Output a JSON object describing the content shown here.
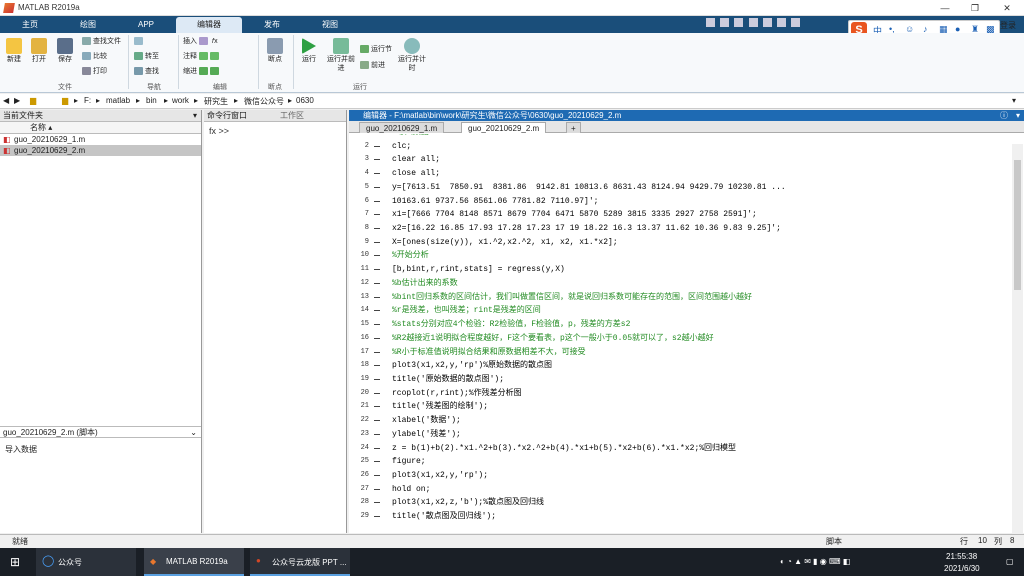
{
  "window": {
    "title": "MATLAB R2019a",
    "login": "登录"
  },
  "tabs": [
    "主页",
    "绘图",
    "APP",
    "编辑器",
    "发布",
    "视图"
  ],
  "ime": {
    "logo": "S",
    "lang": "中"
  },
  "ribbon": {
    "file": {
      "new": "新建",
      "open": "打开",
      "save": "保存",
      "find_files": "查找文件",
      "compare": "比较",
      "print": "打印",
      "group": "文件"
    },
    "nav": {
      "goto": "转至",
      "find": "查找",
      "group": "导航"
    },
    "edit": {
      "insert": "插入",
      "comment": "注释",
      "indent": "缩进",
      "group": "编辑"
    },
    "breakpoints": {
      "label": "断点",
      "group": "断点"
    },
    "run": {
      "run": "运行",
      "run_advance": "运行并前进",
      "run_section": "运行节",
      "advance": "前进",
      "run_time": "运行并计时",
      "group": "运行"
    }
  },
  "address": {
    "parts": [
      "F:",
      "matlab",
      "bin",
      "work",
      "研究生",
      "微信公众号",
      "0630"
    ]
  },
  "current_folder": {
    "title": "当前文件夹",
    "col": "名称 ▴",
    "files": [
      "guo_20210629_1.m",
      "guo_20210629_2.m"
    ],
    "selected": 1,
    "detail_title": "guo_20210629_2.m (脚本)",
    "detail_text": "导入数据"
  },
  "command_window": {
    "title": "命令行窗口",
    "workspace": "工作区",
    "prompt": "fx >>"
  },
  "editor": {
    "title": "编辑器 - F:\\matlab\\bin\\work\\研究生\\微信公众号\\0630\\guo_20210629_2.m",
    "tabs": [
      "guo_20210629_1.m",
      "guo_20210629_2.m"
    ],
    "active_tab": 1,
    "lines": [
      {
        "n": "1",
        "t": "%导入数据",
        "c": true
      },
      {
        "n": "2",
        "t": "clc;"
      },
      {
        "n": "3",
        "t": "clear all;"
      },
      {
        "n": "4",
        "t": "close all;"
      },
      {
        "n": "5",
        "t": "y=[7613.51  7850.91  8381.86  9142.81 10813.6 8631.43 8124.94 9429.79 10230.81 ..."
      },
      {
        "n": "6",
        "t": "10163.61 9737.56 8561.06 7781.82 7110.97]';"
      },
      {
        "n": "7",
        "t": "x1=[7666 7704 8148 8571 8679 7704 6471 5870 5289 3815 3335 2927 2758 2591]';"
      },
      {
        "n": "8",
        "t": "x2=[16.22 16.85 17.93 17.28 17.23 17 19 18.22 16.3 13.37 11.62 10.36 9.83 9.25]';"
      },
      {
        "n": "9",
        "t": "X=[ones(size(y)), x1.^2,x2.^2, x1, x2, x1.*x2];"
      },
      {
        "n": "10",
        "t": "%开始分析",
        "c": true
      },
      {
        "n": "11",
        "t": "[b,bint,r,rint,stats] = regress(y,X)"
      },
      {
        "n": "12",
        "t": "%b估计出来的系数",
        "c": true
      },
      {
        "n": "13",
        "t": "%bint回归系数的区间估计，我们叫做置信区间，就是说回归系数可能存在的范围，区间范围越小越好",
        "c": true
      },
      {
        "n": "14",
        "t": "%r是残差，也叫残差；rint是残差的区间",
        "c": true
      },
      {
        "n": "15",
        "t": "%stats分别对应4个检验：R2检验值，F检验值，p，残差的方差s2",
        "c": true
      },
      {
        "n": "16",
        "t": "%R2越接近1说明拟合程度越好，F这个要看表，p这个一般小于0.05就可以了，s2越小越好",
        "c": true
      },
      {
        "n": "17",
        "t": "%R小于标准值说明拟合结果和原数据相差不大，可接受",
        "c": true
      },
      {
        "n": "18",
        "t": "plot3(x1,x2,y,'rp')%原始数据的散点图"
      },
      {
        "n": "19",
        "t": "title('原始数据的散点图');"
      },
      {
        "n": "20",
        "t": "rcoplot(r,rint);%作残差分析图"
      },
      {
        "n": "21",
        "t": "title('残差图的绘制');"
      },
      {
        "n": "22",
        "t": "xlabel('数据');"
      },
      {
        "n": "23",
        "t": "ylabel('残差');"
      },
      {
        "n": "24",
        "t": "z = b(1)+b(2).*x1.^2+b(3).*x2.^2+b(4).*x1+b(5).*x2+b(6).*x1.*x2;%回归模型"
      },
      {
        "n": "25",
        "t": "figure;"
      },
      {
        "n": "26",
        "t": "plot3(x1,x2,y,'rp');"
      },
      {
        "n": "27",
        "t": "hold on;"
      },
      {
        "n": "28",
        "t": "plot3(x1,x2,z,'b');%散点图及回归线"
      },
      {
        "n": "29",
        "t": "title('散点图及回归线');"
      }
    ]
  },
  "status": {
    "left": "就绪",
    "type": "脚本",
    "row_label": "行",
    "row": "10",
    "col_label": "列",
    "col": "8"
  },
  "taskbar": {
    "search": "公众号",
    "apps": [
      "MATLAB R2019a",
      "公众号云龙版 PPT ..."
    ],
    "time": "21:55:38",
    "date": "2021/6/30"
  }
}
